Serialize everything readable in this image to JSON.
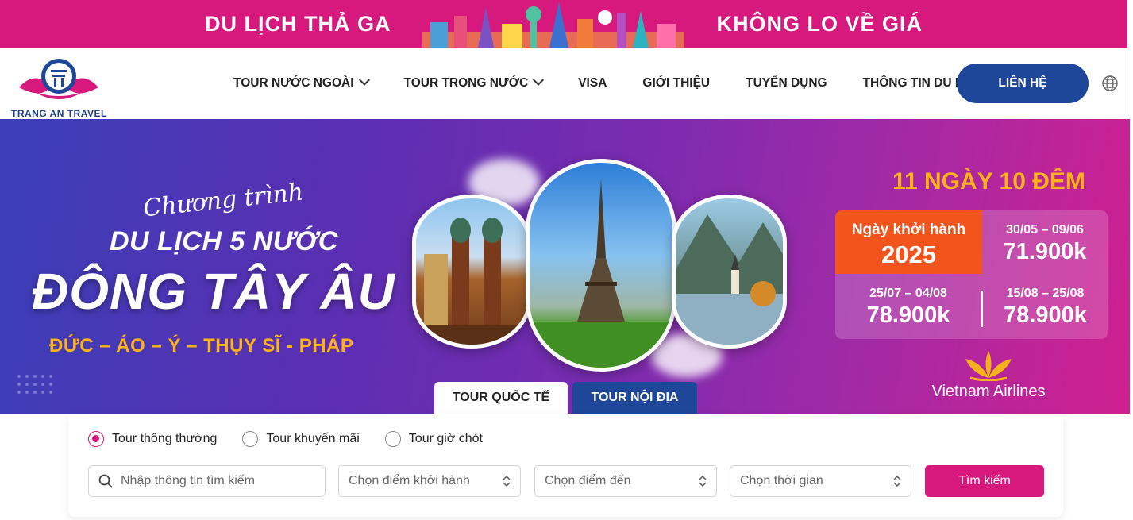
{
  "promo": {
    "left_text": "DU LỊCH THẢ GA",
    "right_text": "KHÔNG LO VỀ GIÁ"
  },
  "header": {
    "brand": "TRANG AN TRAVEL",
    "nav": [
      {
        "label": "TOUR NƯỚC NGOÀI",
        "has_dropdown": true
      },
      {
        "label": "TOUR TRONG NƯỚC",
        "has_dropdown": true
      },
      {
        "label": "VISA",
        "has_dropdown": false
      },
      {
        "label": "GIỚI THIỆU",
        "has_dropdown": false
      },
      {
        "label": "TUYỂN DỤNG",
        "has_dropdown": false
      },
      {
        "label": "THÔNG TIN DU LỊCH",
        "has_dropdown": true
      }
    ],
    "contact_label": "LIÊN HỆ"
  },
  "banner": {
    "script": "Chương trình",
    "line1": "DU LỊCH 5 NƯỚC",
    "line2": "ĐÔNG TÂY ÂU",
    "countries": "ĐỨC – ÁO – Ý – THỤY SĨ  -  PHÁP",
    "duration": "11 NGÀY 10 ĐÊM",
    "depart_label": "Ngày khởi hành",
    "depart_year": "2025",
    "prices": [
      {
        "dates": "30/05 – 09/06",
        "price": "71.900k"
      },
      {
        "dates": "25/07 – 04/08",
        "price": "78.900k"
      },
      {
        "dates": "15/08 – 25/08",
        "price": "78.900k"
      }
    ],
    "airline": "Vietnam Airlines"
  },
  "tabs": {
    "international": "TOUR QUỐC TẾ",
    "domestic": "TOUR NỘI ĐỊA"
  },
  "search": {
    "radios": [
      "Tour thông thường",
      "Tour khuyến mãi",
      "Tour giờ chót"
    ],
    "placeholder": "Nhập thông tin tìm kiếm",
    "select_departure": "Chọn điểm khởi hành",
    "select_destination": "Chọn điểm đến",
    "select_time": "Chọn thời gian",
    "button": "Tìm kiếm"
  },
  "colors": {
    "brand_pink": "#d7197d",
    "brand_blue": "#1e4799",
    "accent_orange": "#f2541b",
    "accent_yellow": "#ffb21a"
  }
}
